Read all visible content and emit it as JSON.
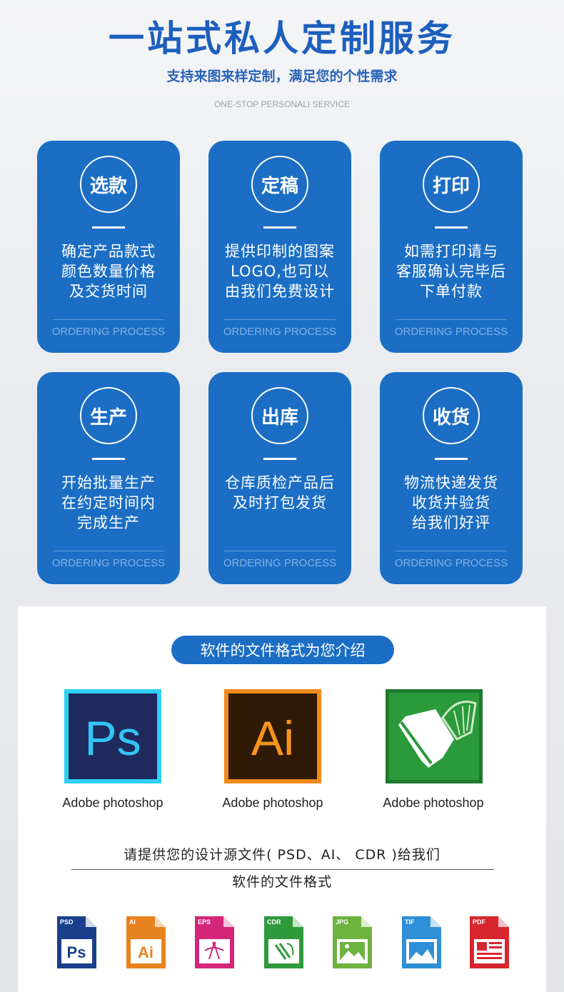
{
  "header": {
    "title": "一站式私人定制服务",
    "subtitle": "支持来图来样定制，满足您的个性需求",
    "english": "ONE-STOP PERSONALI SERVICE"
  },
  "steps": [
    {
      "title": "选款",
      "lines": [
        "确定产品款式",
        "颜色数量价格",
        "及交货时间"
      ],
      "footer": "ORDERING PROCESS"
    },
    {
      "title": "定稿",
      "lines": [
        "提供印制的图案",
        "LOGO,也可以",
        "由我们免费设计"
      ],
      "footer": "ORDERING PROCESS"
    },
    {
      "title": "打印",
      "lines": [
        "如需打印请与",
        "客服确认完毕后",
        "下单付款"
      ],
      "footer": "ORDERING PROCESS"
    },
    {
      "title": "生产",
      "lines": [
        "开始批量生产",
        "在约定时间内",
        "完成生产"
      ],
      "footer": "ORDERING PROCESS"
    },
    {
      "title": "出库",
      "lines": [
        "仓库质检产品后",
        "及时打包发货",
        ""
      ],
      "footer": "ORDERING PROCESS"
    },
    {
      "title": "收货",
      "lines": [
        "物流快递发货",
        "收货并验货",
        "给我们好评"
      ],
      "footer": "ORDERING PROCESS"
    }
  ],
  "software": {
    "pill": "软件的文件格式为您介绍",
    "apps": [
      {
        "icon": "photoshop-icon",
        "icon_text": "Ps",
        "label": "Adobe photoshop"
      },
      {
        "icon": "illustrator-icon",
        "icon_text": "Ai",
        "label": "Adobe photoshop"
      },
      {
        "icon": "coreldraw-icon",
        "icon_text": "",
        "label": "Adobe photoshop"
      }
    ],
    "note_line1": "请提供您的设计源文件( PSD、AI、 CDR )给我们",
    "note_line2": "软件的文件格式",
    "files": [
      {
        "tag": "PSD",
        "glyph": "Ps",
        "color": "#1a3f8a"
      },
      {
        "tag": "AI",
        "glyph": "Ai",
        "color": "#e8821e"
      },
      {
        "tag": "EPS",
        "glyph": "",
        "color": "#d4257a"
      },
      {
        "tag": "CDR",
        "glyph": "",
        "color": "#2e9a3c"
      },
      {
        "tag": "JPG",
        "glyph": "",
        "color": "#6db33f"
      },
      {
        "tag": "TIF",
        "glyph": "",
        "color": "#2f8fd6"
      },
      {
        "tag": "PDF",
        "glyph": "",
        "color": "#d8262e"
      }
    ]
  },
  "colors": {
    "accent": "#1b6ec4",
    "title": "#1d5fbd"
  }
}
